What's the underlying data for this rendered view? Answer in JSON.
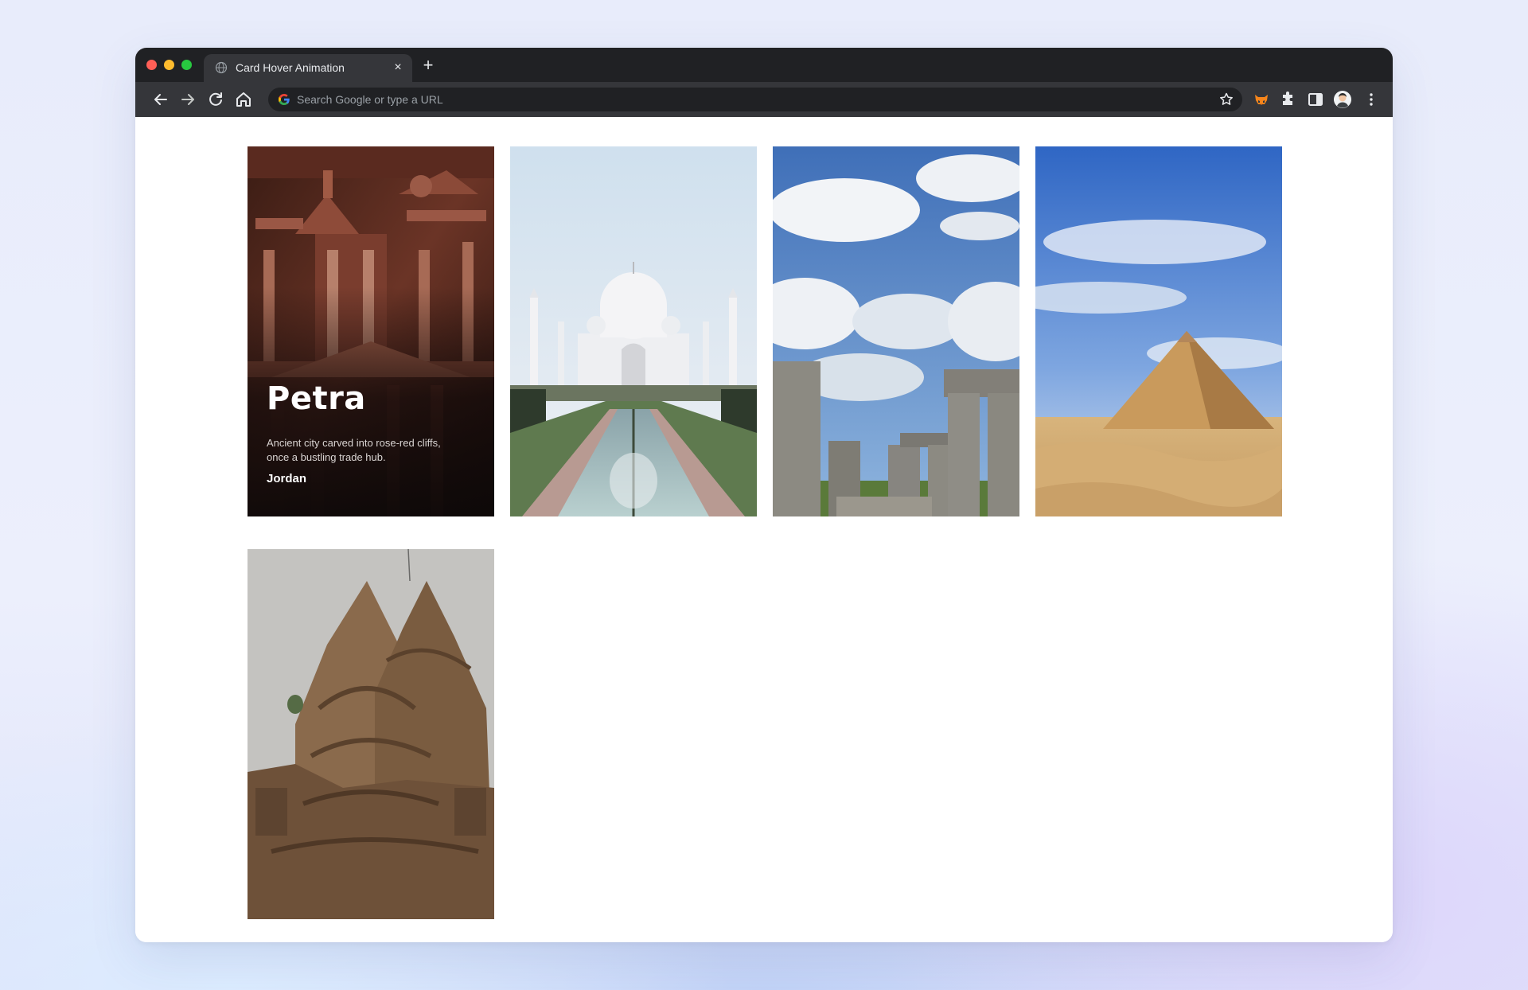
{
  "browser": {
    "tab_title": "Card Hover Animation",
    "tab_close": "×",
    "new_tab": "+",
    "address_placeholder": "Search Google or type a URL"
  },
  "cards": [
    {
      "title": "Petra",
      "description": "Ancient city carved into rose-red cliffs, once a bustling trade hub.",
      "location": "Jordan"
    },
    {},
    {},
    {},
    {}
  ],
  "colors": {
    "titlebar": "#202124",
    "toolbar": "#35363a",
    "omnibox": "#202124",
    "page_background": "#ffffff"
  },
  "icons": {
    "tab": "globe-icon",
    "back": "back-arrow-icon",
    "forward": "forward-arrow-icon",
    "reload": "reload-icon",
    "home": "home-icon",
    "search": "google-logo-icon",
    "bookmark": "star-icon",
    "extension_1": "fox-extension-icon",
    "extensions": "puzzle-icon",
    "side_panel": "side-panel-icon",
    "profile": "avatar",
    "menu": "kebab-menu-icon"
  }
}
